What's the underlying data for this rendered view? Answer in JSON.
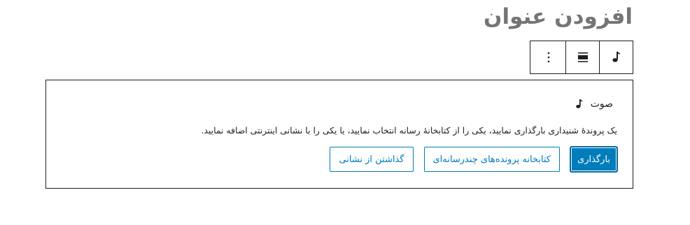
{
  "page": {
    "title": "افزودن عنوان"
  },
  "toolbar": {
    "buttons": [
      {
        "name": "audio-block-icon"
      },
      {
        "name": "align-icon"
      },
      {
        "name": "more-options-icon"
      }
    ]
  },
  "block": {
    "label": "صوت",
    "instructions": "یک پروندهٔ شنیداری بارگذاری نمایید، یکی را از کتابخانهٔ رسانه انتخاب نمایید، یا یکی را با نشانی اینترنتی اضافه نمایید.",
    "upload_label": "بارگذاری",
    "media_library_label": "کتابخانه پرونده‌های چندرسانه‌ای",
    "insert_url_label": "گذاشتن از نشانی"
  },
  "colors": {
    "accent": "#007cba",
    "border": "#1e1e1e",
    "title": "#757575"
  }
}
